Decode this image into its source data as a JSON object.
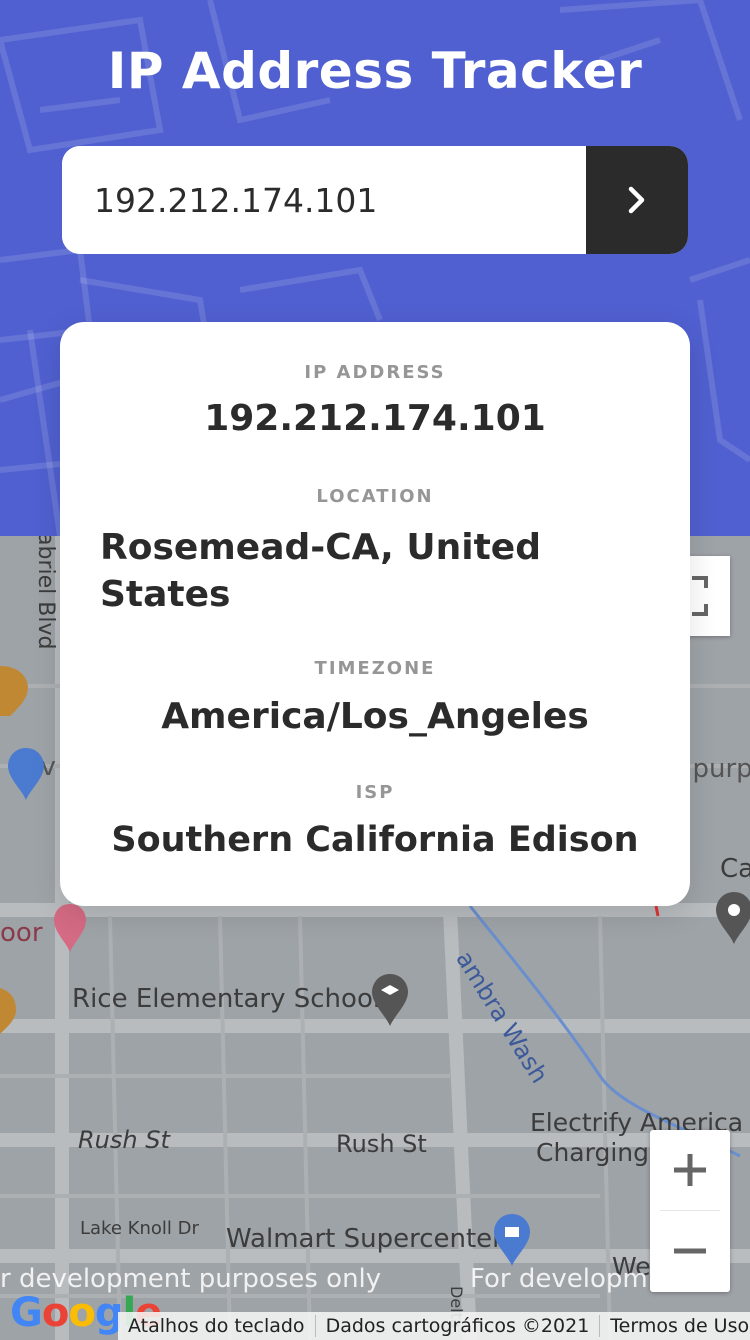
{
  "header": {
    "title": "IP Address Tracker"
  },
  "search": {
    "value": "192.212.174.101",
    "submit_icon": "chevron-right-icon"
  },
  "info": {
    "ip": {
      "label": "IP ADDRESS",
      "value": "192.212.174.101"
    },
    "location": {
      "label": "LOCATION",
      "value": "Rosemead-CA, United States"
    },
    "timezone": {
      "label": "TIMEZONE",
      "value": "America/Los_Angeles"
    },
    "isp": {
      "label": "ISP",
      "value": "Southern California Edison"
    }
  },
  "map": {
    "labels": {
      "street_gabriel": "abriel Blvd",
      "dev_left": "dev",
      "purp_right": "t purp",
      "ca_right": "Ca",
      "door": "oor",
      "wash": "ambra Wash",
      "school": "Rice Elementary School",
      "rush1": "Rush St",
      "rush2": "Rush St",
      "electrify1": "Electrify America",
      "electrify2": "Charging",
      "lake_knoll": "Lake Knoll Dr",
      "walmart": "Walmart Supercenter",
      "delta": "Delta",
      "wells": "Wells"
    },
    "watermark_left": "r development purposes only",
    "watermark_right": "For developm",
    "google": "Google",
    "attribution": {
      "shortcuts": "Atalhos do teclado",
      "data": "Dados cartográficos ©2021",
      "terms": "Termos de Uso"
    },
    "zoom_in": "+",
    "zoom_out": "−"
  }
}
